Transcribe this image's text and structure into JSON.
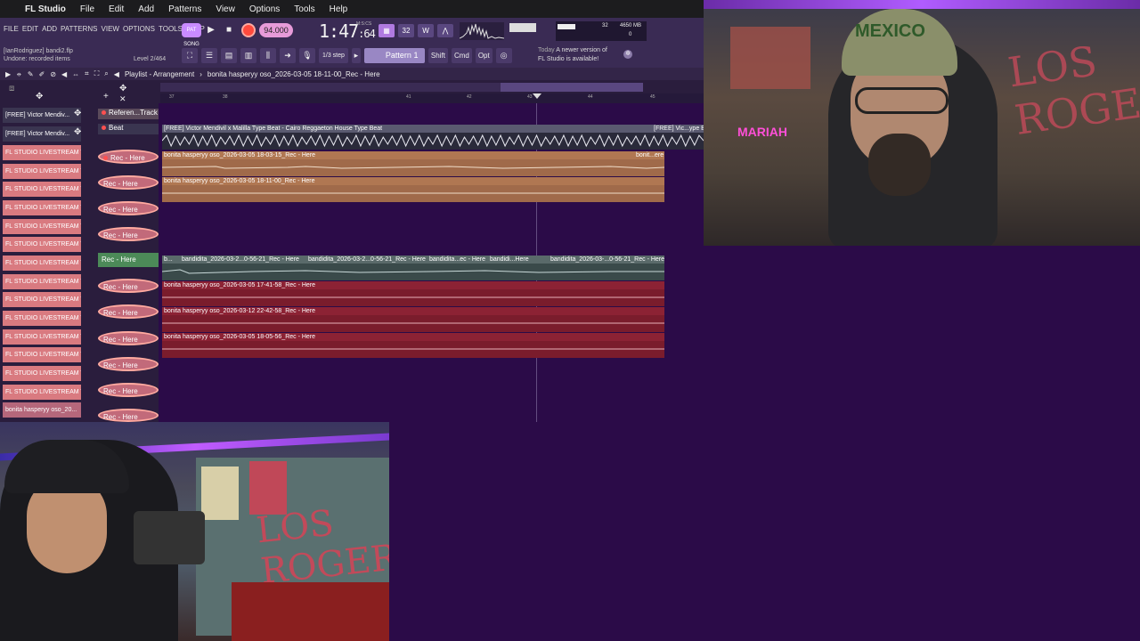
{
  "macbar": {
    "app": "FL Studio",
    "menus": [
      "File",
      "Edit",
      "Add",
      "Patterns",
      "View",
      "Options",
      "Tools",
      "Help"
    ]
  },
  "fl": {
    "menu": [
      "FILE",
      "EDIT",
      "ADD",
      "PATTERNS",
      "VIEW",
      "OPTIONS",
      "TOOLS",
      "HELP"
    ],
    "file_name": "[IanRodriguez] bandi2.flp",
    "undo_status": "Undone: recorded items",
    "level": "Level 2/464",
    "pat_song": "PAT SONG",
    "tempo": "94.000",
    "time_main": "1:47",
    "time_sub": ":64",
    "time_units": "M:S:CS",
    "cpu_value": "32",
    "mem_value": "4650 MB",
    "poly_value": "0",
    "step": "1/3 step",
    "pattern": "Pattern 1",
    "modes": [
      "Shift",
      "Cmd",
      "Opt"
    ],
    "news_label": "Today",
    "news_line1": "A newer version of",
    "news_line2": "FL Studio is available!"
  },
  "playlist": {
    "title": "Playlist - Arrangement",
    "arrow": "›",
    "project": "bonita hasperyy oso_2026-03-05 18-11-00_Rec - Here",
    "ruler": [
      "37",
      "38",
      "41",
      "42",
      "43",
      "44",
      "45"
    ]
  },
  "picker": [
    "[FREE] Victor Mendiv...",
    "[FREE] Victor Mendiv...",
    "FL STUDIO LIVESTREAM T...",
    "FL STUDIO LIVESTREAM T...",
    "FL STUDIO LIVESTREAM T...",
    "FL STUDIO LIVESTREAM T...",
    "FL STUDIO LIVESTREAM T...",
    "FL STUDIO LIVESTREAM T...",
    "FL STUDIO LIVESTREAM T...",
    "FL STUDIO LIVESTREAM T...",
    "FL STUDIO LIVESTREAM T...",
    "FL STUDIO LIVESTREAM T...",
    "FL STUDIO LIVESTREAM T...",
    "FL STUDIO LIVESTREAM T...",
    "FL STUDIO LIVESTREAM T...",
    "FL STUDIO LIVESTREAM T...",
    "bonita hasperyy oso_20..."
  ],
  "tracks": [
    "Referen...Track",
    "Beat",
    "Rec - Here",
    "Rec - Here",
    "Rec - Here",
    "Rec - Here",
    "Rec - Here",
    "Rec - Here",
    "Rec - Here",
    "Rec - Here",
    "Rec - Here",
    "Rec - Here",
    "Rec - Here"
  ],
  "clips": {
    "beat": "[FREE] Victor Mendivil x Malilla Type Beat - Cairo  Reggaeton House Type Beat",
    "beat_end": "[FREE] Vic...ype B",
    "rec1": "bonita hasperyy oso_2026-03-05 18-03-15_Rec - Here",
    "rec1_end": "bonit...ere",
    "rec2": "bonita hasperyy oso_2026-03-05 18-11-00_Rec - Here",
    "green_a": "b...",
    "green_b": "bandidita_2026-03-2...0-56-21_Rec - Here",
    "green_c": "bandidita_2026-03-2...0-56-21_Rec - Here",
    "green_d": "bandidita...ec - Here",
    "green_e": "bandidi...Here",
    "green_f": "bandidita_2026-03-...0-56-21_Rec - Here",
    "red1": "bonita hasperyy oso_2026-03-05 17-41-58_Rec - Here",
    "red2": "bonita hasperyy oso_2026-03-12 22-42-58_Rec - Here",
    "red3": "bonita hasperyy oso_2026-03-05 18-05-56_Rec - Here"
  },
  "webcam1": {
    "cap_text": "MEXICO",
    "wall_text": "LOS ROGERS",
    "sign_text": "MARIAH"
  },
  "webcam2": {
    "wall_text": "LOS ROGERS"
  }
}
